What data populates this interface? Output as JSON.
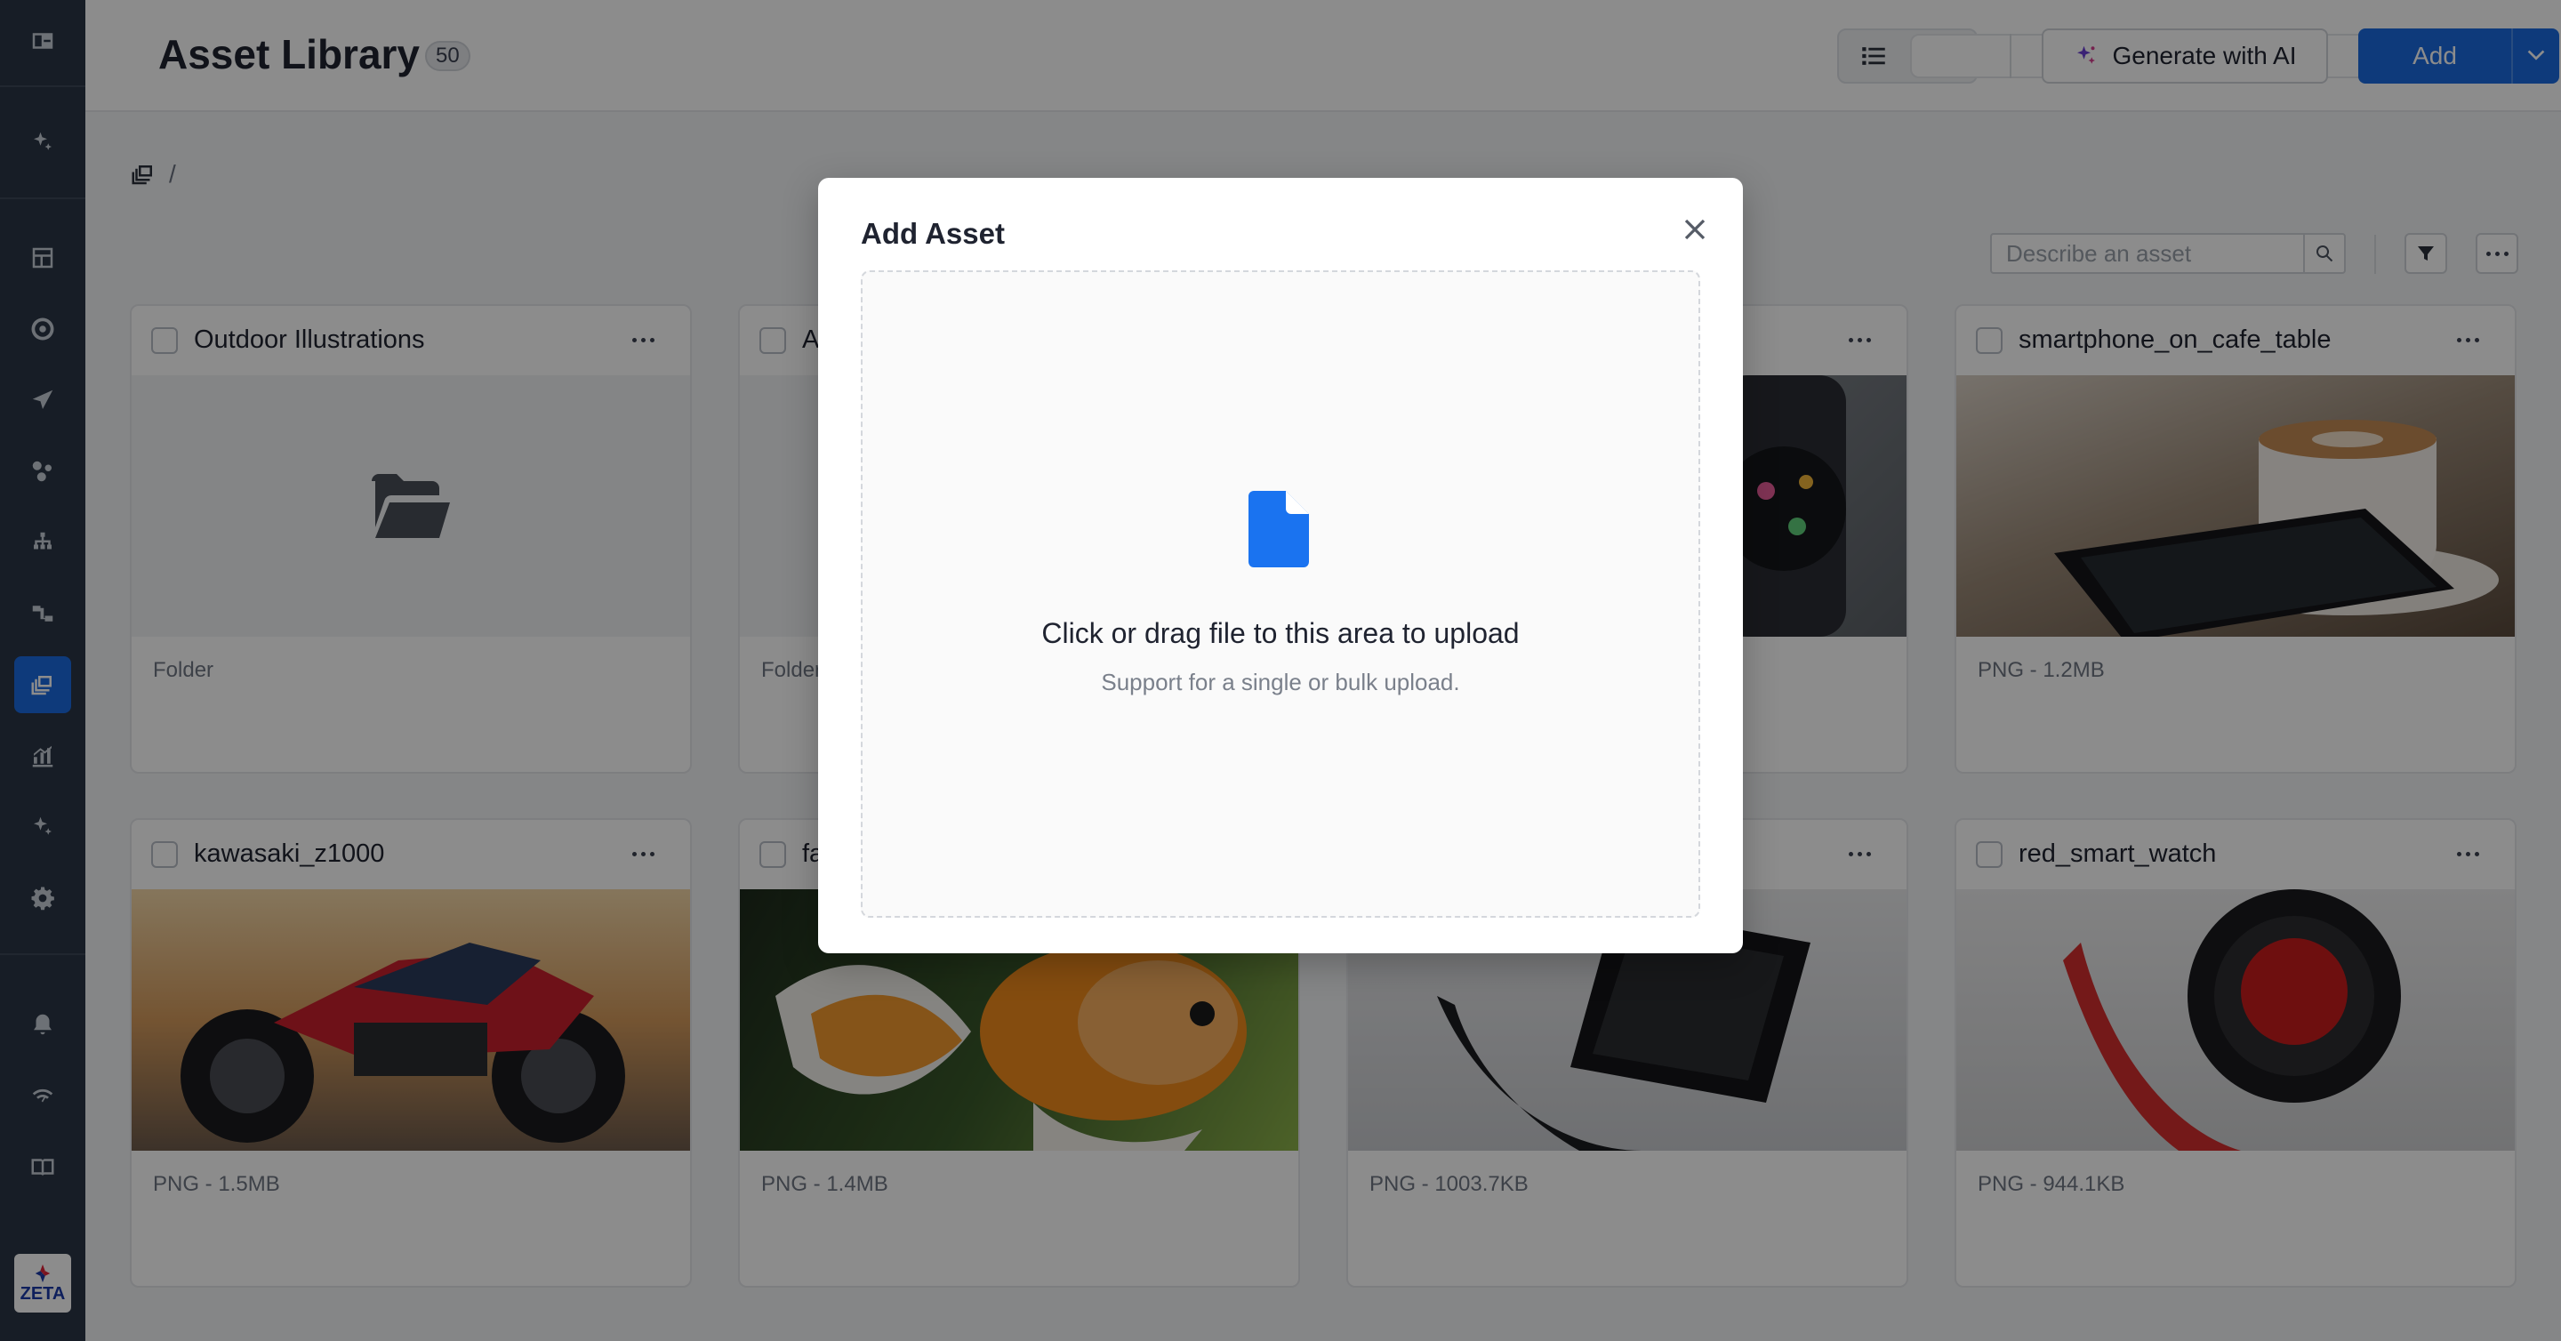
{
  "header": {
    "title": "Asset Library",
    "count": "50",
    "generate_label": "Generate with AI",
    "add_label": "Add"
  },
  "breadcrumb": {
    "separator": "/"
  },
  "toolbar": {
    "search_placeholder": "Describe an asset"
  },
  "cards": [
    {
      "title": "Outdoor Illustrations",
      "meta": "Folder"
    },
    {
      "title": "A",
      "meta": "Folder"
    },
    {
      "title": "",
      "meta": ""
    },
    {
      "title": "smartphone_on_cafe_table",
      "meta": "PNG - 1.2MB"
    },
    {
      "title": "kawasaki_z1000",
      "meta": "PNG - 1.5MB"
    },
    {
      "title": "fa",
      "meta": "PNG - 1.4MB"
    },
    {
      "title": "",
      "meta": "PNG - 1003.7KB"
    },
    {
      "title": "red_smart_watch",
      "meta": "PNG - 944.1KB"
    }
  ],
  "modal": {
    "title": "Add Asset",
    "upload_text": "Click or drag file to this area to upload",
    "upload_hint": "Support for a single or bulk upload."
  },
  "logo": {
    "text": "ZETA"
  },
  "colors": {
    "primary": "#1a6be0",
    "sidebar": "#2b3645"
  },
  "icons": {
    "sidebar": [
      "panel-toggle-icon",
      "sparkle-icon",
      "dashboard-icon",
      "target-icon",
      "send-icon",
      "segments-icon",
      "hierarchy-icon",
      "flow-icon",
      "asset-library-icon",
      "analytics-icon",
      "ai-sparkle-icon",
      "settings-icon",
      "bell-icon",
      "signal-icon",
      "docs-icon"
    ]
  }
}
